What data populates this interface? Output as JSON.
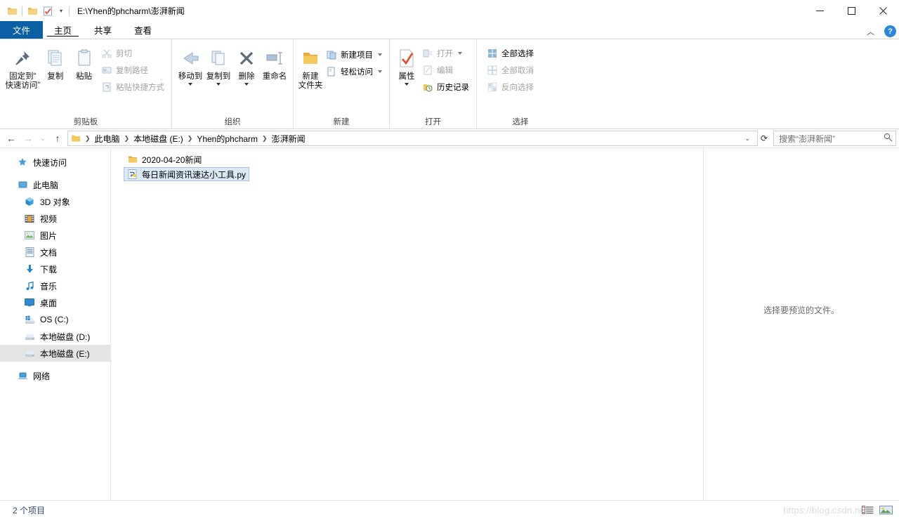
{
  "window": {
    "title": "E:\\Yhen的phcharm\\澎湃新闻",
    "quick_access": [
      {
        "name": "folder-icon",
        "label": "文件夹"
      },
      {
        "name": "folder-icon",
        "label": "文件夹"
      },
      {
        "name": "properties-icon",
        "label": "属性"
      }
    ],
    "controls": {
      "minimize": "最小化",
      "maximize": "最大化",
      "close": "关闭"
    }
  },
  "tabs": [
    {
      "id": "file",
      "label": "文件",
      "active": false,
      "style": "file"
    },
    {
      "id": "home",
      "label": "主页",
      "active": true,
      "style": "normal"
    },
    {
      "id": "share",
      "label": "共享",
      "active": false,
      "style": "normal"
    },
    {
      "id": "view",
      "label": "查看",
      "active": false,
      "style": "normal"
    }
  ],
  "tabstrip_right": {
    "collapse_icon": "chevron-up-icon",
    "help_label": "?"
  },
  "ribbon": {
    "groups": [
      {
        "id": "clipboard",
        "label": "剪贴板",
        "big": [
          {
            "id": "pin",
            "icon": "pin-icon",
            "line1": "固定到“",
            "line2": "快速访问”"
          },
          {
            "id": "copy",
            "icon": "copy-icon",
            "line1": "复制",
            "line2": ""
          },
          {
            "id": "paste",
            "icon": "paste-icon",
            "line1": "粘贴",
            "line2": ""
          }
        ],
        "small": [
          {
            "id": "cut",
            "icon": "scissors-icon",
            "label": "剪切",
            "dim": true
          },
          {
            "id": "copy-path",
            "icon": "copy-path-icon",
            "label": "复制路径",
            "dim": true
          },
          {
            "id": "paste-shortcut",
            "icon": "paste-shortcut-icon",
            "label": "粘贴快捷方式",
            "dim": true
          }
        ]
      },
      {
        "id": "organize",
        "label": "组织",
        "big": [
          {
            "id": "move-to",
            "icon": "move-to-icon",
            "line1": "移动到",
            "line2": "",
            "caret": true
          },
          {
            "id": "copy-to",
            "icon": "copy-to-icon",
            "line1": "复制到",
            "line2": "",
            "caret": true
          },
          {
            "id": "delete",
            "icon": "delete-icon",
            "line1": "删除",
            "line2": "",
            "caret": true
          },
          {
            "id": "rename",
            "icon": "rename-icon",
            "line1": "重命名",
            "line2": ""
          }
        ],
        "small": []
      },
      {
        "id": "new",
        "label": "新建",
        "big": [
          {
            "id": "new-folder",
            "icon": "new-folder-icon",
            "line1": "新建",
            "line2": "文件夹"
          }
        ],
        "small": [
          {
            "id": "new-item",
            "icon": "new-item-icon",
            "label": "新建项目",
            "dim": false,
            "caret": true
          },
          {
            "id": "easy-access",
            "icon": "easy-access-icon",
            "label": "轻松访问",
            "dim": false,
            "caret": true
          }
        ]
      },
      {
        "id": "open",
        "label": "打开",
        "big": [
          {
            "id": "properties",
            "icon": "properties-icon",
            "line1": "属性",
            "line2": "",
            "caret": true
          }
        ],
        "small": [
          {
            "id": "open",
            "icon": "open-icon",
            "label": "打开",
            "dim": true,
            "caret": true
          },
          {
            "id": "edit",
            "icon": "edit-icon",
            "label": "编辑",
            "dim": true
          },
          {
            "id": "history",
            "icon": "history-icon",
            "label": "历史记录",
            "dim": false
          }
        ]
      },
      {
        "id": "select",
        "label": "选择",
        "big": [],
        "small": [
          {
            "id": "select-all",
            "icon": "select-all-icon",
            "label": "全部选择",
            "dim": false
          },
          {
            "id": "select-none",
            "icon": "select-none-icon",
            "label": "全部取消",
            "dim": true
          },
          {
            "id": "invert-selection",
            "icon": "invert-selection-icon",
            "label": "反向选择",
            "dim": true
          }
        ]
      }
    ]
  },
  "address": {
    "back_icon": "arrow-left-icon",
    "forward_icon": "arrow-right-icon",
    "recent_icon": "chevron-down-icon",
    "up_icon": "arrow-up-icon",
    "breadcrumbs": [
      "此电脑",
      "本地磁盘 (E:)",
      "Yhen的phcharm",
      "澎湃新闻"
    ],
    "separator": "❯",
    "dropdown_icon": "chevron-down-icon",
    "refresh_icon": "refresh-icon"
  },
  "search": {
    "placeholder": "搜索“澎湃新闻”",
    "icon": "search-icon"
  },
  "sidebar": {
    "items": [
      {
        "id": "quick-access",
        "label": "快速访问",
        "icon": "star-icon",
        "indent": false,
        "selected": false,
        "gap_after": true
      },
      {
        "id": "this-pc",
        "label": "此电脑",
        "icon": "computer-icon",
        "indent": false,
        "selected": false
      },
      {
        "id": "3d-objects",
        "label": "3D 对象",
        "icon": "3d-objects-icon",
        "indent": true,
        "selected": false
      },
      {
        "id": "videos",
        "label": "视频",
        "icon": "videos-icon",
        "indent": true,
        "selected": false
      },
      {
        "id": "pictures",
        "label": "图片",
        "icon": "pictures-icon",
        "indent": true,
        "selected": false
      },
      {
        "id": "documents",
        "label": "文档",
        "icon": "documents-icon",
        "indent": true,
        "selected": false
      },
      {
        "id": "downloads",
        "label": "下载",
        "icon": "downloads-icon",
        "indent": true,
        "selected": false
      },
      {
        "id": "music",
        "label": "音乐",
        "icon": "music-icon",
        "indent": true,
        "selected": false
      },
      {
        "id": "desktop",
        "label": "桌面",
        "icon": "desktop-icon",
        "indent": true,
        "selected": false
      },
      {
        "id": "os-c",
        "label": "OS (C:)",
        "icon": "windows-drive-icon",
        "indent": true,
        "selected": false
      },
      {
        "id": "disk-d",
        "label": "本地磁盘 (D:)",
        "icon": "drive-icon",
        "indent": true,
        "selected": false
      },
      {
        "id": "disk-e",
        "label": "本地磁盘 (E:)",
        "icon": "drive-icon",
        "indent": true,
        "selected": true,
        "gap_after": true
      },
      {
        "id": "network",
        "label": "网络",
        "icon": "network-icon",
        "indent": false,
        "selected": false
      }
    ]
  },
  "files": [
    {
      "id": "folder-news",
      "name": "2020-04-20新闻",
      "icon": "folder-icon",
      "selected": false
    },
    {
      "id": "py-tool",
      "name": "每日新闻资讯速达小工具.py",
      "icon": "python-file-icon",
      "selected": true
    }
  ],
  "preview": {
    "message": "选择要预览的文件。"
  },
  "statusbar": {
    "count": "2 个项目",
    "watermark": "https://blog.csdn.ne",
    "views": [
      {
        "id": "details-view",
        "icon": "details-view-icon"
      },
      {
        "id": "large-icons-view",
        "icon": "large-icons-view-icon"
      }
    ]
  },
  "colors": {
    "file_tab": "#0b5fa5",
    "help_blue": "#2b88d8",
    "selection_fill": "#dbe8f5",
    "selection_border": "#a9c4df",
    "nav_selected": "#e4e4e4",
    "status_text": "#30456b"
  }
}
